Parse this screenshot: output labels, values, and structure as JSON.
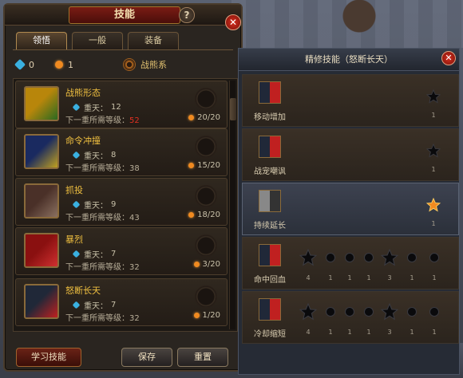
{
  "window": {
    "title": "技能",
    "help_icon": "?",
    "close_icon": "✕"
  },
  "tabs": [
    {
      "label": "领悟",
      "active": true
    },
    {
      "label": "一般",
      "active": false
    },
    {
      "label": "装备",
      "active": false
    }
  ],
  "counters": {
    "blue_points": "0",
    "orange_points": "1",
    "school": "战熊系"
  },
  "skills": [
    {
      "name": "战熊形态",
      "heavens_label": "重天：",
      "heavens": "12",
      "req_label": "下一重所需等级：",
      "req": "52",
      "req_red": true,
      "progress": "20/20",
      "icon_colors": [
        "#b8860b",
        "#2a6a20"
      ]
    },
    {
      "name": "命令冲撞",
      "heavens_label": "重天：",
      "heavens": "8",
      "req_label": "下一重所需等级：",
      "req": "38",
      "req_red": false,
      "progress": "15/20",
      "icon_colors": [
        "#1a2a60",
        "#c0a020"
      ]
    },
    {
      "name": "抓投",
      "heavens_label": "重天：",
      "heavens": "9",
      "req_label": "下一重所需等级：",
      "req": "43",
      "req_red": false,
      "progress": "18/20",
      "icon_colors": [
        "#4a3028",
        "#8a7060"
      ]
    },
    {
      "name": "暴烈",
      "heavens_label": "重天：",
      "heavens": "7",
      "req_label": "下一重所需等级：",
      "req": "32",
      "req_red": false,
      "progress": "3/20",
      "icon_colors": [
        "#8a1010",
        "#d03030"
      ]
    },
    {
      "name": "怒断长天",
      "heavens_label": "重天：",
      "heavens": "7",
      "req_label": "下一重所需等级：",
      "req": "32",
      "req_red": false,
      "progress": "1/20",
      "icon_colors": [
        "#202838",
        "#c02020"
      ]
    }
  ],
  "buttons": {
    "learn": "学习技能",
    "save": "保存",
    "reset": "重置"
  },
  "refine": {
    "title": "精修技能（怒断长天）",
    "close_icon": "✕",
    "rows": [
      {
        "name": "移动增加",
        "selected": false,
        "stars": [
          {
            "level": "1",
            "lit": false
          }
        ]
      },
      {
        "name": "战宠嘲讽",
        "selected": false,
        "stars": [
          {
            "level": "1",
            "lit": false
          }
        ]
      },
      {
        "name": "持续延长",
        "selected": true,
        "gray_icon": true,
        "stars": [
          {
            "level": "1",
            "lit": true
          }
        ]
      },
      {
        "name": "命中回血",
        "selected": false,
        "chain": [
          "4",
          "1",
          "1",
          "1",
          "3",
          "1",
          "1"
        ]
      },
      {
        "name": "冷却缩短",
        "selected": false,
        "chain": [
          "4",
          "1",
          "1",
          "1",
          "3",
          "1",
          "1"
        ]
      }
    ]
  },
  "colors": {
    "accent_red": "#e03020",
    "gold": "#f0c040",
    "blue": "#3ab0e0",
    "orange": "#f08a20"
  }
}
